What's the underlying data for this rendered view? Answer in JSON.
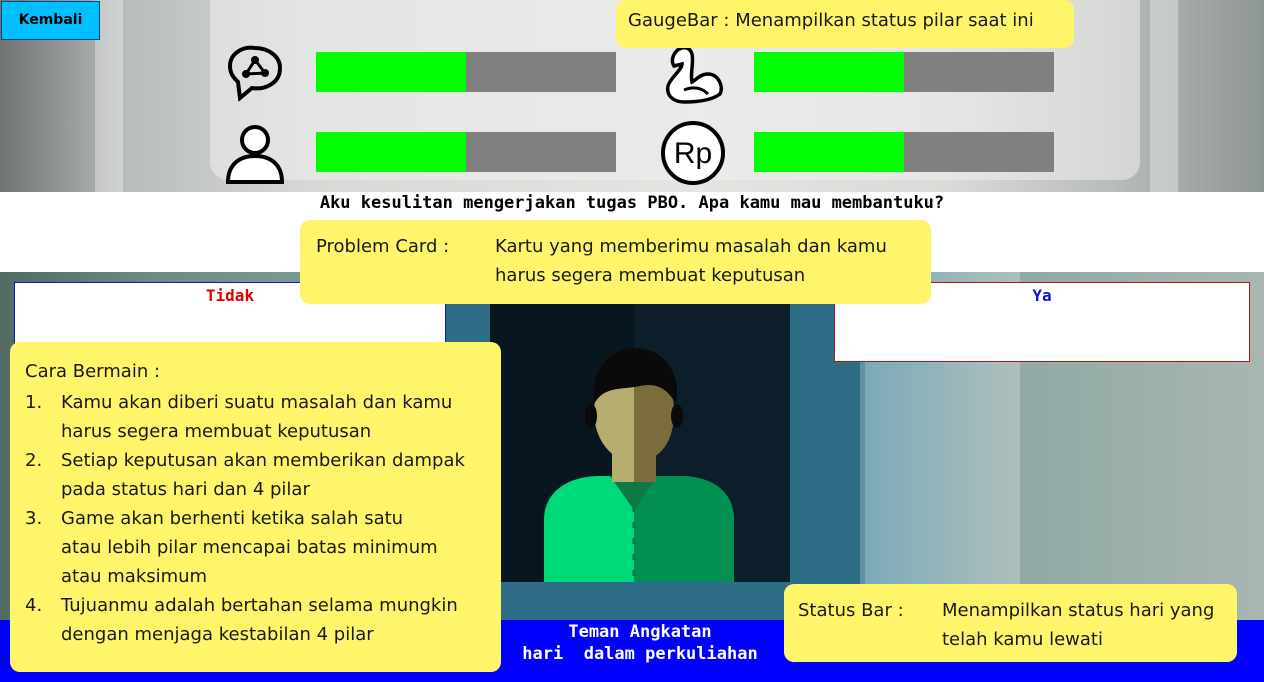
{
  "nav": {
    "back_label": "Kembali"
  },
  "gauges": [
    {
      "name": "mind",
      "icon": "brain-icon",
      "level": 0.5
    },
    {
      "name": "health",
      "icon": "muscle-arm-icon",
      "level": 0.5
    },
    {
      "name": "social",
      "icon": "person-icon",
      "level": 0.5
    },
    {
      "name": "money",
      "icon": "rupiah-coin-icon",
      "level": 0.5
    }
  ],
  "gauge_colors": {
    "fill": "#00ff00",
    "track": "#808080"
  },
  "card": {
    "question": "Aku kesulitan mengerjakan tugas PBO. Apa kamu mau membantuku?",
    "left_choice": "Tidak",
    "right_choice": "Ya",
    "character_name": "Teman Angkatan"
  },
  "status": {
    "day_text": "hari  dalam perkuliahan"
  },
  "tutorial": {
    "gauge_tip": {
      "key": "GaugeBar :",
      "value": "Menampilkan status pilar saat ini"
    },
    "problem_tip": {
      "key": "Problem Card :",
      "value_line1": "Kartu yang memberimu masalah dan kamu",
      "value_line2": "harus segera membuat keputusan"
    },
    "status_tip": {
      "key": "Status Bar :",
      "value_line1": "Menampilkan status hari yang",
      "value_line2": "telah kamu lewati"
    },
    "howto": {
      "title": "Cara Bermain :",
      "steps": [
        {
          "num": "1.",
          "line1": "Kamu akan diberi suatu masalah dan kamu",
          "line2": "harus segera membuat keputusan",
          "line3": ""
        },
        {
          "num": "2.",
          "line1": "Setiap keputusan akan memberikan dampak",
          "line2": "pada status hari dan 4 pilar",
          "line3": ""
        },
        {
          "num": "3.",
          "line1": "Game akan berhenti ketika salah satu",
          "line2": "atau lebih pilar mencapai batas minimum",
          "line3": "atau maksimum"
        },
        {
          "num": "4.",
          "line1": "Tujuanmu adalah bertahan selama mungkin",
          "line2": "dengan menjaga kestabilan 4 pilar",
          "line3": ""
        }
      ]
    }
  },
  "colors": {
    "tip_bg": "#fff56a",
    "status_bar": "#0000ff",
    "back_button": "#00bfff",
    "no_text": "#e00000",
    "yes_text": "#1010c8"
  }
}
